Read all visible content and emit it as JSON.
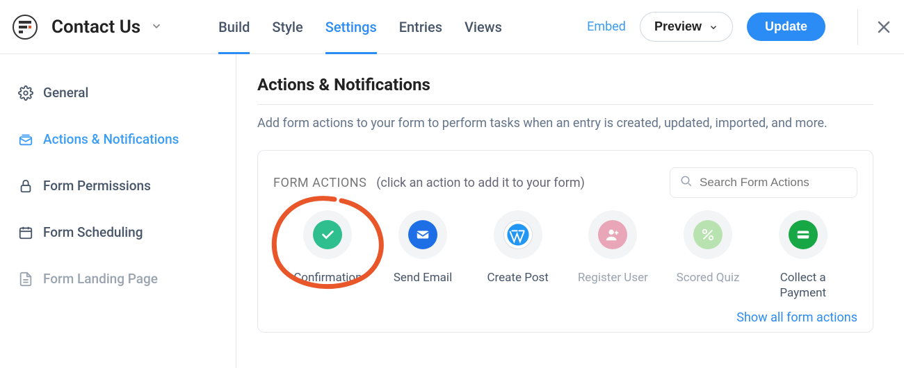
{
  "header": {
    "title": "Contact Us",
    "tabs": [
      "Build",
      "Style",
      "Settings",
      "Entries",
      "Views"
    ],
    "active_tab": "Settings",
    "embed": "Embed",
    "preview": "Preview",
    "update": "Update"
  },
  "sidebar": {
    "items": [
      {
        "label": "General",
        "icon": "gear"
      },
      {
        "label": "Actions & Notifications",
        "icon": "mail",
        "active": true
      },
      {
        "label": "Form Permissions",
        "icon": "lock"
      },
      {
        "label": "Form Scheduling",
        "icon": "calendar"
      },
      {
        "label": "Form Landing Page",
        "icon": "page",
        "disabled": true
      }
    ]
  },
  "main": {
    "heading": "Actions & Notifications",
    "desc": "Add form actions to your form to perform tasks when an entry is created, updated, imported, and more.",
    "panel_label": "FORM ACTIONS",
    "panel_hint": "(click an action to add it to your form)",
    "search_placeholder": "Search Form Actions",
    "show_all": "Show all form actions",
    "actions": [
      {
        "label": "Confirmation",
        "color": "#2fbf8f",
        "icon": "check"
      },
      {
        "label": "Send Email",
        "color": "#1e6fe6",
        "icon": "mail"
      },
      {
        "label": "Create Post",
        "color": "#2196f3",
        "icon": "wp"
      },
      {
        "label": "Register User",
        "color": "#e9a6b8",
        "icon": "user",
        "disabled": true
      },
      {
        "label": "Scored Quiz",
        "color": "#b8e3b0",
        "icon": "percent",
        "disabled": true
      },
      {
        "label": "Collect a Payment",
        "color": "#18a745",
        "icon": "card"
      }
    ]
  }
}
